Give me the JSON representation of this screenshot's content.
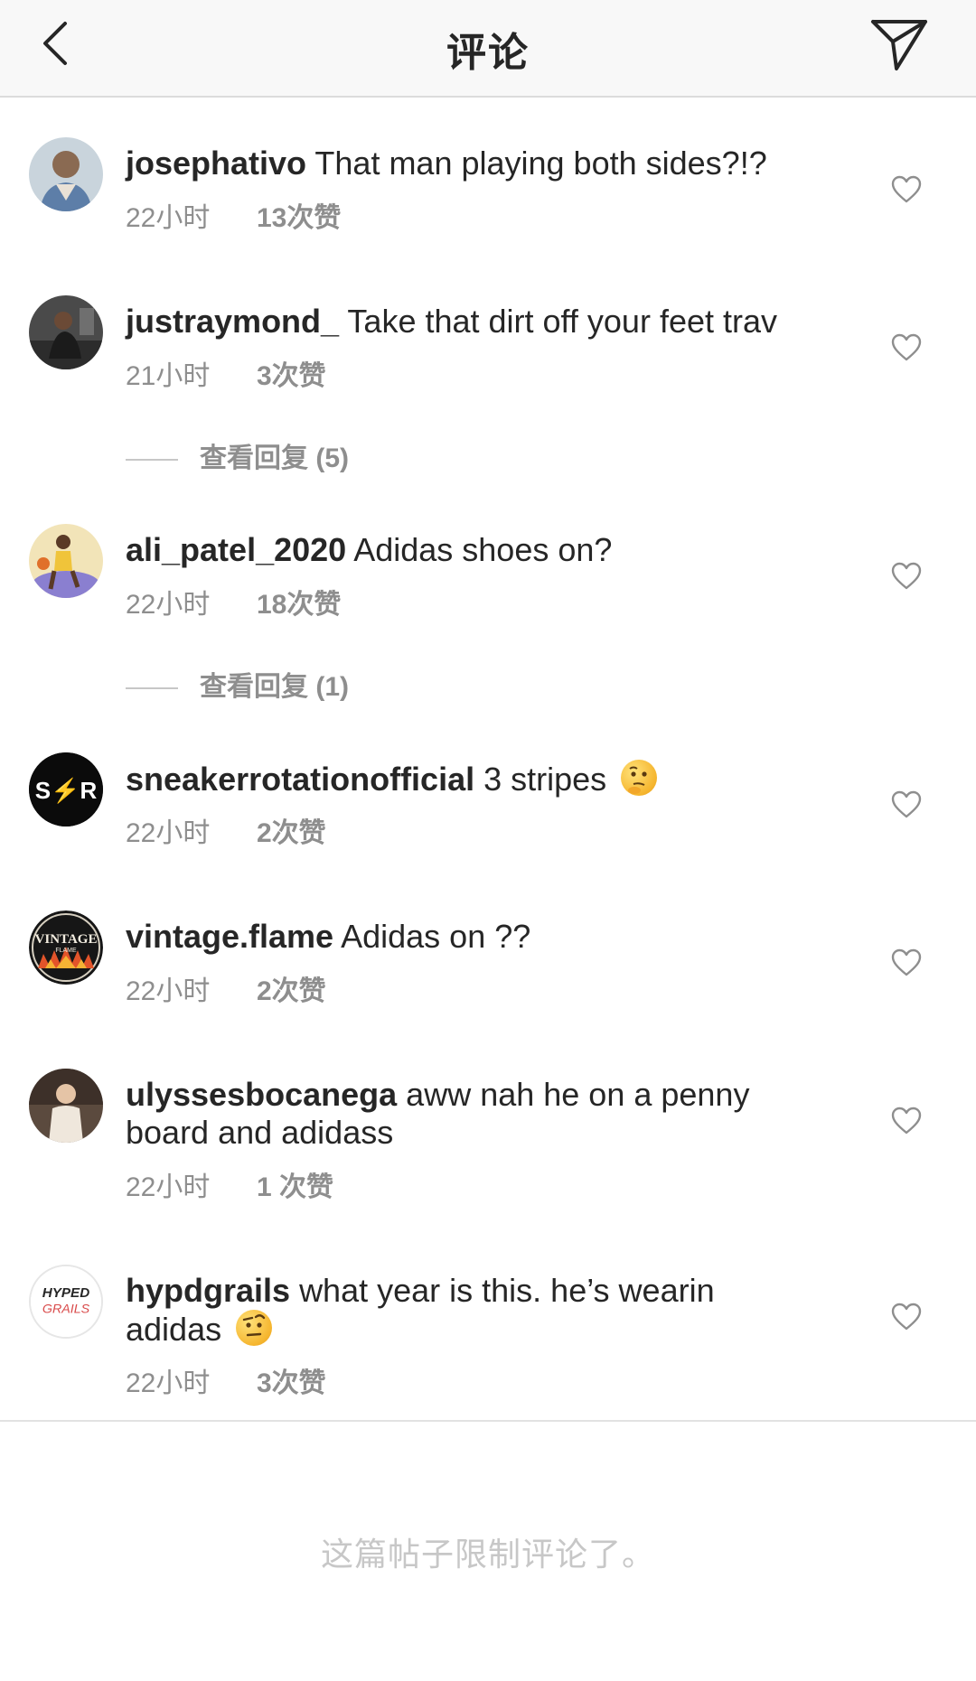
{
  "header": {
    "title": "评论"
  },
  "comments": [
    {
      "username": "josephativo",
      "text": "That man playing both sides?!?",
      "time": "22小时",
      "likes": "13次赞"
    },
    {
      "username": "justraymond_",
      "text": "Take that dirt off your feet trav",
      "time": "21小时",
      "likes": "3次赞",
      "replies": "查看回复 (5)"
    },
    {
      "username": "ali_patel_2020",
      "text": "Adidas shoes on?",
      "time": "22小时",
      "likes": "18次赞",
      "replies": "查看回复 (1)"
    },
    {
      "username": "sneakerrotationofficial",
      "text": "3 stripes",
      "time": "22小时",
      "likes": "2次赞",
      "avatar_text": "S⚡R"
    },
    {
      "username": "vintage.flame",
      "text": "Adidas on ??",
      "time": "22小时",
      "likes": "2次赞",
      "avatar_text": "VINTAGE",
      "avatar_subtext": "FLAME"
    },
    {
      "username": "ulyssesbocanega",
      "text": "aww nah he on a penny board and adidass",
      "time": "22小时",
      "likes": "1 次赞"
    },
    {
      "username": "hypdgrails",
      "text": "what year is this. he’s wearin adidas",
      "time": "22小时",
      "likes": "3次赞",
      "avatar_text": "HYPED",
      "avatar_subtext": "GRAILS"
    }
  ],
  "footer": {
    "note": "这篇帖子限制评论了。"
  },
  "colors": {
    "text": "#262626",
    "meta": "#8e8e8e",
    "note": "#c7c7c7",
    "header_bg": "#f8f8f8"
  },
  "icons": {
    "back": "chevron-left-icon",
    "send": "paper-plane-icon",
    "like": "heart-outline-icon",
    "emoji_thinking": "thinking-face-emoji",
    "emoji_raised_eyebrow": "raised-eyebrow-face-emoji"
  }
}
